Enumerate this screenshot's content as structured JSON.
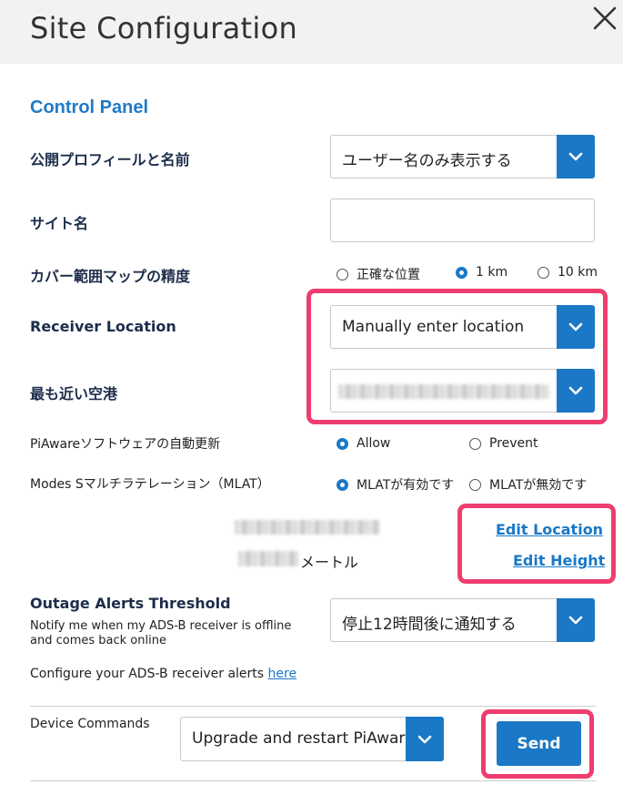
{
  "window": {
    "title": "Site Configuration"
  },
  "panel": {
    "title": "Control Panel"
  },
  "profile": {
    "label": "公開プロフィールと名前",
    "selected": "ユーザー名のみ表示する"
  },
  "site_name": {
    "label": "サイト名",
    "value": ""
  },
  "coverage": {
    "label": "カバー範囲マップの精度",
    "options": [
      {
        "label": "正確な位置",
        "selected": false
      },
      {
        "label": "1 km",
        "selected": true
      },
      {
        "label": "10 km",
        "selected": false
      }
    ]
  },
  "receiver_location": {
    "label": "Receiver Location",
    "selected": "Manually enter location"
  },
  "nearest_airport": {
    "label": "最も近い空港",
    "selected": ""
  },
  "auto_update": {
    "label": "PiAwareソフトウェアの自動更新",
    "options": [
      {
        "label": "Allow",
        "selected": true
      },
      {
        "label": "Prevent",
        "selected": false
      }
    ]
  },
  "mlat": {
    "label": "Modes Sマルチラテレーション（MLAT）",
    "options": [
      {
        "label": "MLATが有効です",
        "selected": true
      },
      {
        "label": "MLATが無効です",
        "selected": false
      }
    ]
  },
  "location_info": {
    "height_unit": "メートル"
  },
  "links": {
    "edit_location": "Edit Location",
    "edit_height": "Edit Height"
  },
  "outage": {
    "label": "Outage Alerts Threshold",
    "description_line1": "Notify me when my ADS-B receiver is offline",
    "description_line2": "and comes back online",
    "selected": "停止12時間後に通知する"
  },
  "alerts": {
    "text": "Configure your ADS-B receiver alerts",
    "link": "here"
  },
  "device_commands": {
    "label": "Device Commands",
    "selected": "Upgrade and restart PiAware",
    "send_label": "Send"
  },
  "colors": {
    "accent": "#1a78c6",
    "highlight": "#ee3d6e",
    "header_bg": "#f2f2f2",
    "title": "#1f7bc7"
  },
  "icons": {
    "close": "close-icon",
    "dropdown": "chevron-down-icon"
  }
}
